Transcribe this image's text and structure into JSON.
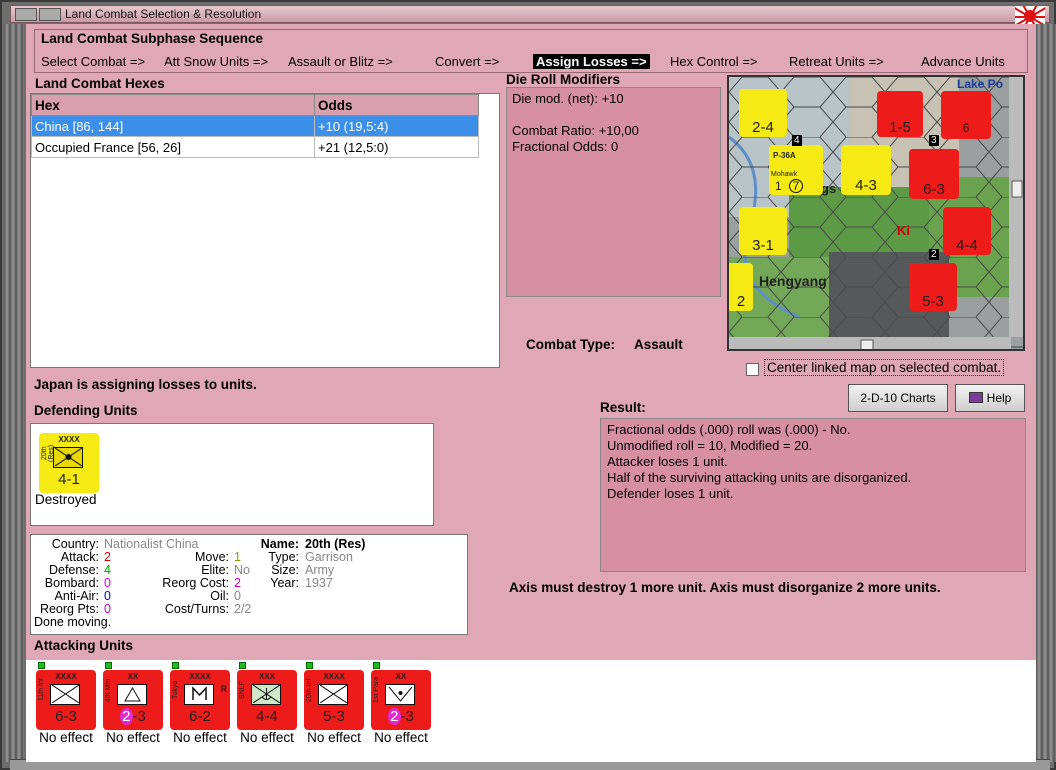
{
  "window": {
    "title": "Land Combat Selection & Resolution"
  },
  "subphase": {
    "heading": "Land Combat Subphase Sequence",
    "steps": [
      "Select Combat =>",
      "Att Snow Units =>",
      "Assault or Blitz =>",
      "Convert =>",
      "Assign Losses =>",
      "Hex Control =>",
      "Retreat Units =>",
      "Advance Units"
    ],
    "selected_index": 4
  },
  "hexes": {
    "heading": "Land Combat Hexes",
    "columns": [
      "Hex",
      "Odds"
    ],
    "rows": [
      {
        "hex": "China [86, 144]",
        "odds": "+10 (19,5:4)",
        "selected": true
      },
      {
        "hex": "Occupied France [56, 26]",
        "odds": "+21 (12,5:0)",
        "selected": false
      }
    ]
  },
  "die_roll": {
    "heading": "Die Roll Modifiers",
    "lines": [
      "Die mod. (net): +10",
      "",
      "Combat Ratio: +10,00",
      "Fractional Odds: 0"
    ]
  },
  "combat_type": {
    "label": "Combat Type:",
    "value": "Assault"
  },
  "map": {
    "labels": [
      "Lake Po",
      "Hengyang",
      "Ki",
      "gs"
    ],
    "units": [
      {
        "value": "2-4",
        "color": "yellow"
      },
      {
        "value": "1-5",
        "color": "red"
      },
      {
        "value": "6",
        "color": "red"
      },
      {
        "value": "1",
        "color": "yellow",
        "name": "P-36A",
        "subname": "Mohawk",
        "circle": "7"
      },
      {
        "value": "4-3",
        "color": "yellow"
      },
      {
        "value": "6-3",
        "color": "red"
      },
      {
        "value": "3-1",
        "color": "yellow"
      },
      {
        "value": "4-4",
        "color": "red"
      },
      {
        "value": "5-3",
        "color": "red"
      },
      {
        "value": "2",
        "color": "yellow"
      }
    ],
    "hex_numbers": [
      "4",
      "3",
      "2"
    ]
  },
  "center_map": {
    "label": "Center linked map on selected combat.",
    "checked": false
  },
  "buttons": {
    "charts": "2-D-10 Charts",
    "help": "Help"
  },
  "status": "Japan is assigning losses to units.",
  "defending": {
    "heading": "Defending Units",
    "units": [
      {
        "size": "XXXX",
        "side": "20th (Res)",
        "value": "4-1",
        "caption": "Destroyed",
        "color": "yellow"
      }
    ]
  },
  "unit_info": {
    "country_label": "Country:",
    "country": "Nationalist China",
    "attack_label": "Attack:",
    "attack": "2",
    "defense_label": "Defense:",
    "defense": "4",
    "bombard_label": "Bombard:",
    "bombard": "0",
    "antiair_label": "Anti-Air:",
    "antiair": "0",
    "reorg_pts_label": "Reorg Pts:",
    "reorg_pts": "0",
    "done": "Done moving.",
    "move_label": "Move:",
    "move": "1",
    "elite_label": "Elite:",
    "elite": "No",
    "reorg_cost_label": "Reorg Cost:",
    "reorg_cost": "2",
    "oil_label": "Oil:",
    "oil": "0",
    "cost_turns_label": "Cost/Turns:",
    "cost_turns": "2/2",
    "name_label": "Name:",
    "name": "20th (Res)",
    "type_label": "Type:",
    "type": "Garrison",
    "size_label": "Size:",
    "size": "Army",
    "year_label": "Year:",
    "year": "1937"
  },
  "result": {
    "heading": "Result:",
    "lines": [
      "Fractional odds (.000) roll was (.000)  - No.",
      "Unmodified roll = 10, Modified = 20.",
      "Attacker loses 1 unit.",
      "Half of the surviving attacking units are disorganized.",
      "Defender loses 1 unit."
    ]
  },
  "axis_note": "Axis must destroy 1 more unit. Axis must disorganize 2 more units.",
  "attacking": {
    "heading": "Attacking Units",
    "units": [
      {
        "size": "XXXX",
        "side": "11th Inf",
        "value": "6-3",
        "caption": "No effect",
        "color": "red",
        "sym": "inf"
      },
      {
        "size": "XX",
        "side": "4th Mtn",
        "value_a": "2",
        "value_b": "-3",
        "caption": "No effect",
        "color": "red",
        "sym": "mtn"
      },
      {
        "size": "XXXX",
        "side": "Tokyo",
        "value": "6-2",
        "caption": "No effect",
        "color": "red",
        "sym": "mech",
        "badge": "R"
      },
      {
        "size": "XXX",
        "side": "SNLF",
        "value": "4-4",
        "caption": "No effect",
        "color": "red",
        "sym": "marine"
      },
      {
        "size": "XXXX",
        "side": "20th Inf",
        "value": "5-3",
        "caption": "No effect",
        "color": "red",
        "sym": "inf"
      },
      {
        "size": "XX",
        "side": "1st Para",
        "value_a": "2",
        "value_b": "-3",
        "caption": "No effect",
        "color": "red",
        "sym": "para"
      }
    ]
  },
  "colors": {
    "panel": "#e0a8b6",
    "selection": "#3c8fe8",
    "unit_red": "#ee1b1b",
    "unit_yellow": "#f6ea15"
  }
}
